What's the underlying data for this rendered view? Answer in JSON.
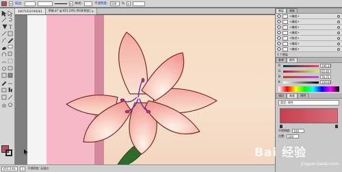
{
  "control_bar": {
    "fill_color": "#c44a58",
    "stroke_label": "描边:",
    "style_label": "样式:",
    "opacity_label": "不透明度:",
    "opacity_value": "100",
    "opacity_unit": "%"
  },
  "document": {
    "tab_title": "20071010749161",
    "tab2_title": "草稿.ai* @ 651.24% (RGB/预览)",
    "close_glyph": "✕"
  },
  "layers": {
    "items": [
      {
        "name": "<编组>"
      },
      {
        "name": "<编组>"
      },
      {
        "name": "<编组>"
      },
      {
        "name": "<编组>"
      },
      {
        "name": "<路径>"
      },
      {
        "name": "<编组>"
      },
      {
        "name": "<编组>"
      }
    ],
    "footer": "1 个图层"
  },
  "color_panel": {
    "tab_label": "颜色",
    "channels": [
      {
        "ch": "R",
        "value": "196.33"
      },
      {
        "ch": "G",
        "value": "65.65"
      },
      {
        "ch": "B",
        "value": "76.72"
      },
      {
        "ch": "K",
        "value": "100.00"
      }
    ]
  },
  "gradient_panel": {
    "tab_label": "渐变",
    "type_label": "类型: 线性",
    "opacity_label": "不透明度:",
    "opacity_value": "100",
    "location_label": "位置:",
    "location_value": "100"
  },
  "status_bar": {
    "zoom": "651.24%",
    "page": "1",
    "tool_info": "不透明度: 无描边"
  },
  "watermark": {
    "text": "Bai 经验",
    "sub": "jingyan.baidu.com"
  },
  "colors": {
    "accent": "#c44a58",
    "pink_band": "#f6b8c6",
    "peach_bg": "#f6dcc4"
  }
}
